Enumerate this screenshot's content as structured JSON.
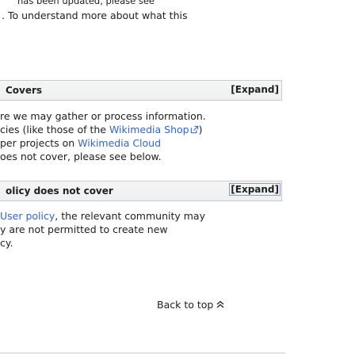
{
  "top": {
    "clipped_line": "has been updated, please see",
    "line2": ". To understand more about what this"
  },
  "section1": {
    "title": "Covers",
    "expand_label": "[Expand]",
    "p1": "re we may gather or process information.",
    "p2_pre": "cies (like those of the ",
    "p2_link": "Wikimedia Shop",
    "p2_post": ")",
    "p3_pre": "per projects on ",
    "p3_link": "Wikimedia Cloud",
    "p4": "oes not cover, please see below."
  },
  "section2": {
    "title": "olicy does not cover",
    "expand_label": "[Expand]",
    "p1_link": "User policy",
    "p1_post": ", the relevant community may",
    "p2": "y are not permitted to create new",
    "p3": "cy."
  },
  "footer": {
    "back_to_top": "Back to top"
  },
  "icons": {
    "external_link": "external-link-icon",
    "up_arrow": "double-chevron-up-icon"
  },
  "colors": {
    "link": "#3366cc",
    "text": "#202122",
    "border": "#c8ccd1",
    "section_bg": "#f2f3f4"
  }
}
